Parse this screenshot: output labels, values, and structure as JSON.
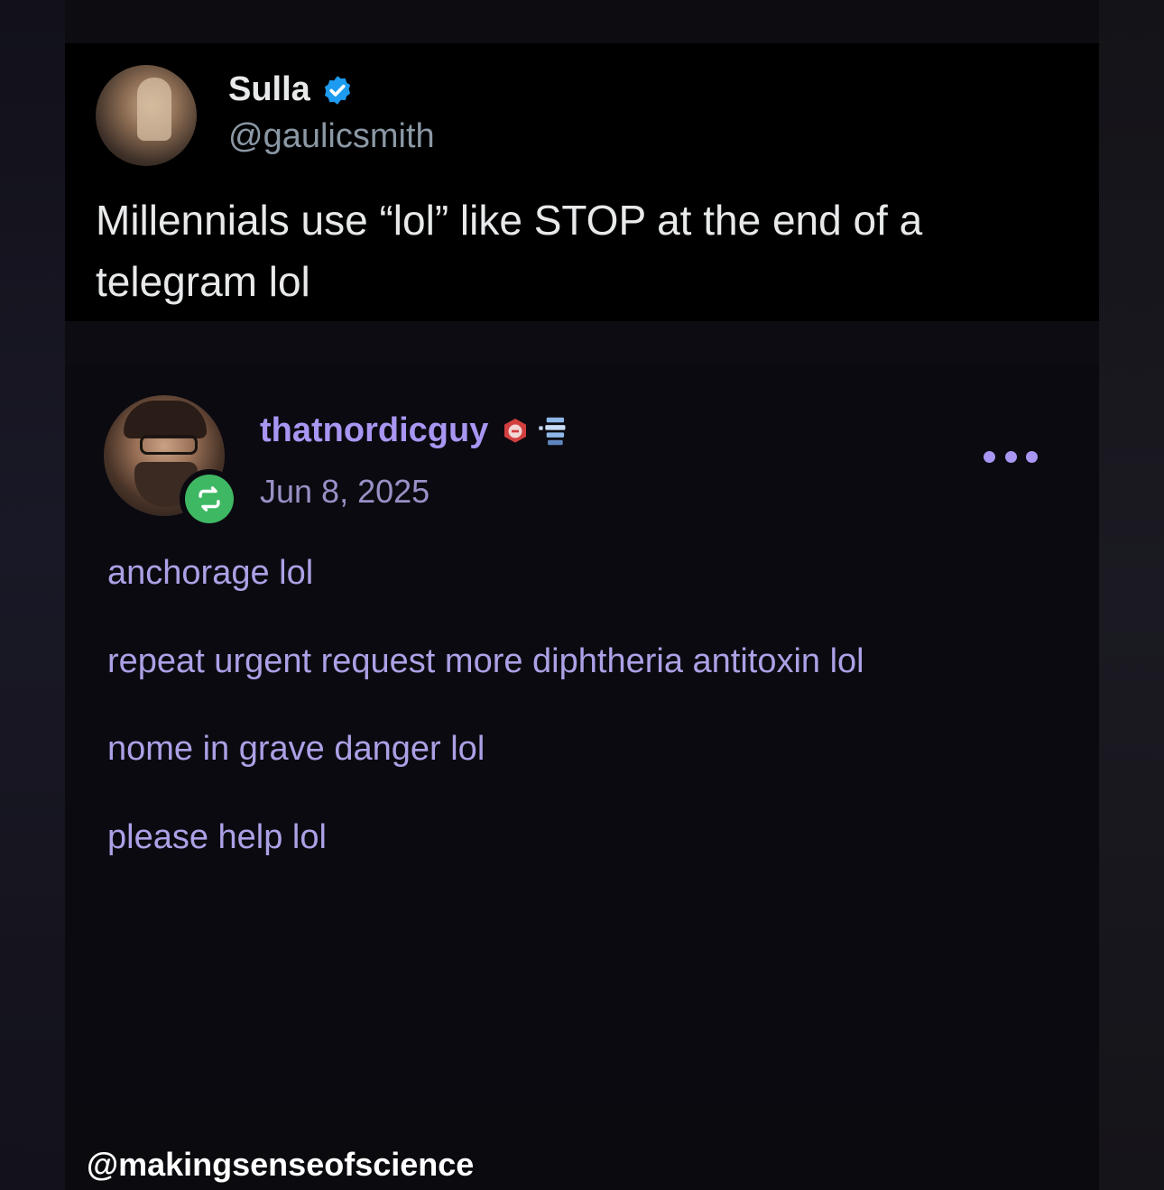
{
  "tweet": {
    "display_name": "Sulla",
    "handle": "@gaulicsmith",
    "text": "Millennials use “lol” like STOP at the end of a telegram lol",
    "verified_color": "#1d9bf0"
  },
  "post": {
    "username": "thatnordicguy",
    "date": "Jun 8, 2025",
    "lines": [
      "anchorage lol",
      "repeat urgent request more diphtheria antitoxin lol",
      "nome in grave danger lol",
      "please help lol"
    ],
    "accent_color": "#a896f2",
    "reblog_color": "#3fb864"
  },
  "watermark": "@makingsenseofscience"
}
